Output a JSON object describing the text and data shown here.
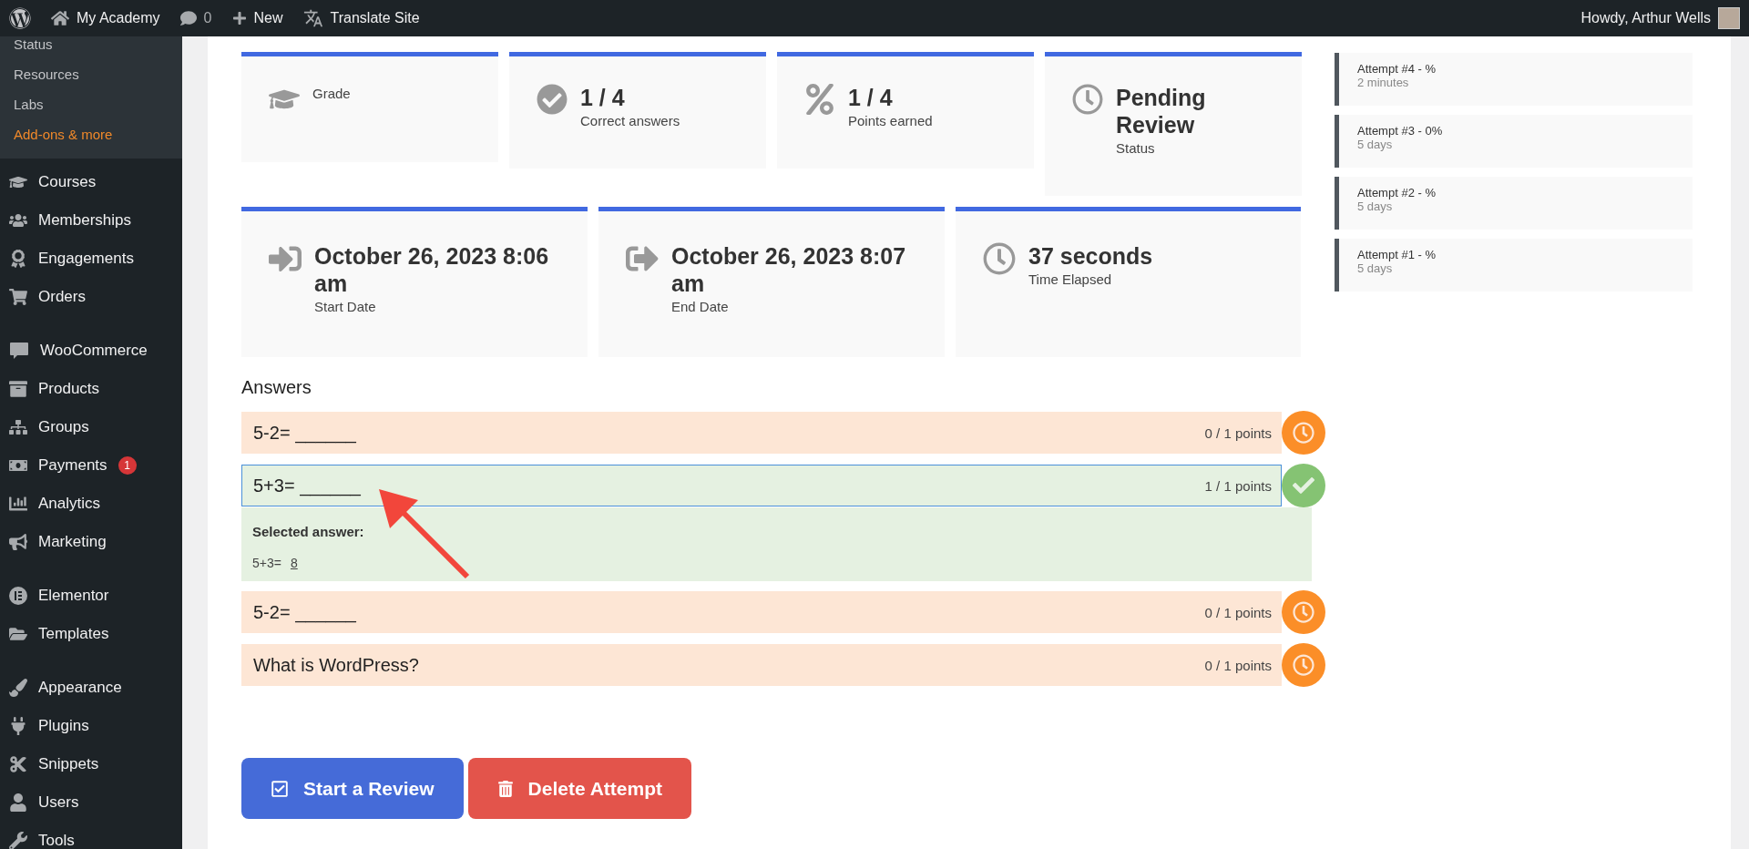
{
  "admin_bar": {
    "site": "My Academy",
    "comments": "0",
    "new": "New",
    "translate": "Translate Site",
    "greeting": "Howdy, Arthur Wells"
  },
  "sidebar": {
    "submenu": [
      {
        "label": "Status",
        "selected": false
      },
      {
        "label": "Resources",
        "selected": false
      },
      {
        "label": "Labs",
        "selected": false
      },
      {
        "label": "Add-ons & more",
        "selected": true
      }
    ],
    "groups": [
      [
        {
          "label": "Courses"
        },
        {
          "label": "Memberships"
        },
        {
          "label": "Engagements"
        },
        {
          "label": "Orders"
        }
      ],
      [
        {
          "label": "WooCommerce"
        },
        {
          "label": "Products"
        },
        {
          "label": "Groups"
        },
        {
          "label": "Payments",
          "badge": "1"
        },
        {
          "label": "Analytics"
        },
        {
          "label": "Marketing"
        }
      ],
      [
        {
          "label": "Elementor"
        },
        {
          "label": "Templates"
        }
      ],
      [
        {
          "label": "Appearance"
        },
        {
          "label": "Plugins"
        },
        {
          "label": "Snippets"
        },
        {
          "label": "Users"
        },
        {
          "label": "Tools"
        }
      ]
    ]
  },
  "summary": [
    {
      "label": "Grade"
    },
    {
      "value": "1 / 4",
      "label": "Correct answers"
    },
    {
      "value": "1 / 4",
      "label": "Points earned"
    },
    {
      "value": "Pending Review",
      "label": "Status"
    }
  ],
  "timing": [
    {
      "value": "October 26, 2023 8:06 am",
      "label": "Start Date"
    },
    {
      "value": "October 26, 2023 8:07 am",
      "label": "End Date"
    },
    {
      "value": "37 seconds",
      "label": "Time Elapsed"
    }
  ],
  "answers": {
    "title": "Answers",
    "items": [
      {
        "question": "5-2= ______",
        "points": "0 / 1 points",
        "kind": "pending",
        "expanded": false
      },
      {
        "question": "5+3= ______",
        "points": "1 / 1 points",
        "kind": "correct",
        "expanded": true,
        "selected_label": "Selected answer:",
        "selected_prompt": "5+3=",
        "selected_value": "8"
      },
      {
        "question": "5-2= ______",
        "points": "0 / 1 points",
        "kind": "pending",
        "expanded": false
      },
      {
        "question": "What is WordPress?",
        "points": "0 / 1 points",
        "kind": "pending",
        "expanded": false
      }
    ]
  },
  "buttons": {
    "review": "Start a Review",
    "delete": "Delete Attempt"
  },
  "attempts": [
    {
      "title": "Attempt #4 - %",
      "time": "2 minutes"
    },
    {
      "title": "Attempt #3 - 0%",
      "time": "5 days"
    },
    {
      "title": "Attempt #2 - %",
      "time": "5 days"
    },
    {
      "title": "Attempt #1 - %",
      "time": "5 days"
    }
  ]
}
